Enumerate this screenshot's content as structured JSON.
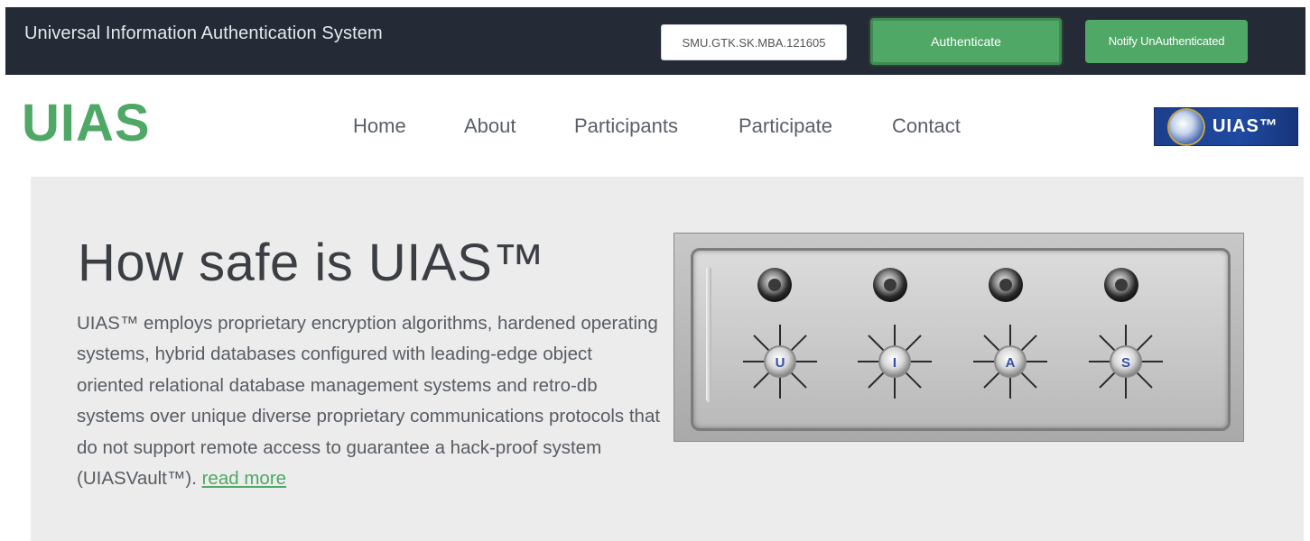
{
  "topbar": {
    "title": "Universal Information Authentication System",
    "code_value": "SMU.GTK.SK.MBA.121605",
    "authenticate_label": "Authenticate",
    "notify_label": "Notify UnAuthenticated"
  },
  "navbar": {
    "brand": "UIAS",
    "items": [
      "Home",
      "About",
      "Participants",
      "Participate",
      "Contact"
    ],
    "logo_text": "UIAS™"
  },
  "hero": {
    "title": "How safe is UIAS™",
    "body": "UIAS™ employs proprietary encryption algorithms, hardened operating systems, hybrid databases configured with leading-edge object oriented relational database management systems and retro-db systems over unique diverse proprietary communications protocols that do not support remote access to guarantee a hack-proof system (UIASVault™).",
    "read_more": "read more",
    "dial_letters": [
      "U",
      "I",
      "A",
      "S"
    ]
  },
  "colors": {
    "accent_green": "#4fa865",
    "topbar_bg": "#242b36",
    "hero_bg": "#ececec",
    "logo_blue": "#1f4aa0"
  },
  "icons": {
    "logo_globe": "globe-icon"
  }
}
